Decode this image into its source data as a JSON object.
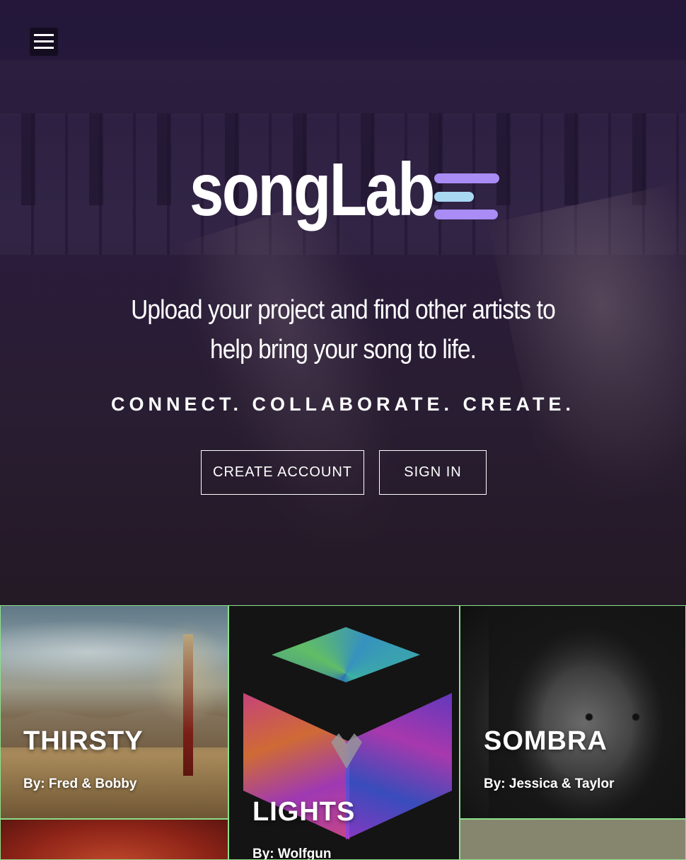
{
  "hero": {
    "logo_text": "songLab",
    "tagline": "Upload your project and find other artists to help bring your song to life.",
    "slogan": "CONNECT. COLLABORATE. CREATE.",
    "create_account_label": "CREATE ACCOUNT",
    "sign_in_label": "SIGN IN"
  },
  "colors": {
    "logo_purple": "#a98cf5",
    "logo_blue": "#a9d8f3",
    "tile_border": "#8be08b",
    "hero_bg": "#24173a"
  },
  "projects": [
    {
      "title": "THIRSTY",
      "by": "By: Fred & Bobby"
    },
    {
      "title": "LIGHTS",
      "by": "By: Wolfgun"
    },
    {
      "title": "SOMBRA",
      "by": "By: Jessica & Taylor"
    }
  ],
  "icons": {
    "menu": "hamburger-menu-icon",
    "logo_mark": "logo-bars-icon"
  }
}
